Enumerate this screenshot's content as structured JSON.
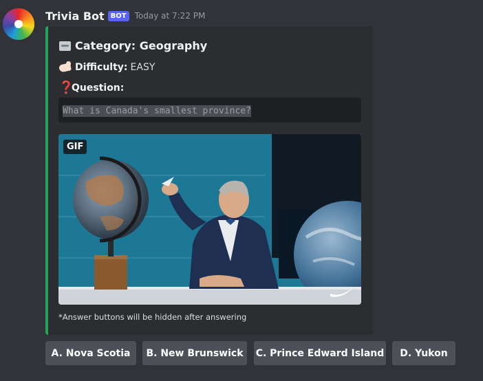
{
  "message": {
    "username": "Trivia Bot",
    "bot_tag": "BOT",
    "timestamp": "Today at 7:22 PM"
  },
  "embed": {
    "accent_color": "#23a55a",
    "category": "Category: Geography",
    "difficulty_label": "Difficulty:",
    "difficulty_value": "EASY",
    "question_label": "Question:",
    "question_text": "What is Canada's smallest province?",
    "gif_badge": "GIF",
    "footer": "*Answer buttons will be hidden after answering",
    "icons": [
      "card-file-box-icon",
      "flexed-biceps-icon",
      "question-mark-icon"
    ]
  },
  "answers": [
    {
      "label": "A. Nova Scotia"
    },
    {
      "label": "B. New Brunswick"
    },
    {
      "label": "C. Prince Edward Island"
    },
    {
      "label": "D. Yukon"
    }
  ],
  "colors": {
    "background": "#313338",
    "embed_background": "#2b2d31",
    "bot_tag": "#5865f2",
    "button": "#4e5058"
  }
}
